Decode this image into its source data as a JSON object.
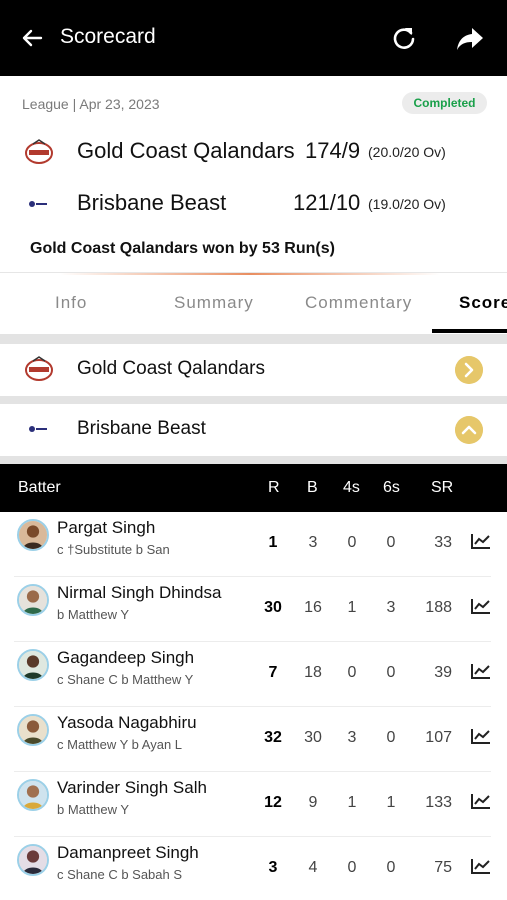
{
  "header": {
    "title": "Scorecard",
    "icons": [
      "back-arrow-icon",
      "refresh-icon",
      "share-icon"
    ]
  },
  "match": {
    "meta": "League | Apr 23, 2023",
    "status": "Completed",
    "status_color": "#1aa04a",
    "teams": [
      {
        "name": "Gold Coast Qalandars",
        "score": "174/9",
        "overs": "(20.0/20 Ov)"
      },
      {
        "name": "Brisbane Beast",
        "score": "121/10",
        "overs": "(19.0/20 Ov)"
      }
    ],
    "result": "Gold Coast Qalandars won by 53 Run(s)"
  },
  "tabs": [
    {
      "label": "Info"
    },
    {
      "label": "Summary"
    },
    {
      "label": "Commentary"
    },
    {
      "label": "Score",
      "active": true
    }
  ],
  "innings": [
    {
      "name": "Gold Coast Qalandars",
      "expanded": false
    },
    {
      "name": "Brisbane Beast",
      "expanded": true
    }
  ],
  "accent_color": "#e6c76a",
  "batting": {
    "columns": [
      "Batter",
      "R",
      "B",
      "4s",
      "6s",
      "SR"
    ],
    "rows": [
      {
        "name": "Pargat Singh",
        "dismissal": "c †Substitute b San",
        "r": "1",
        "b": "3",
        "fours": "0",
        "sixes": "0",
        "sr": "33"
      },
      {
        "name": "Nirmal Singh Dhindsa",
        "dismissal": "b Matthew Y",
        "r": "30",
        "b": "16",
        "fours": "1",
        "sixes": "3",
        "sr": "188"
      },
      {
        "name": "Gagandeep Singh",
        "dismissal": "c Shane C b Matthew Y",
        "r": "7",
        "b": "18",
        "fours": "0",
        "sixes": "0",
        "sr": "39"
      },
      {
        "name": "Yasoda Nagabhiru",
        "dismissal": "c Matthew Y b Ayan L",
        "r": "32",
        "b": "30",
        "fours": "3",
        "sixes": "0",
        "sr": "107"
      },
      {
        "name": "Varinder Singh Salh",
        "dismissal": "b Matthew Y",
        "r": "12",
        "b": "9",
        "fours": "1",
        "sixes": "1",
        "sr": "133"
      },
      {
        "name": "Damanpreet Singh",
        "dismissal": "c Shane C b Sabah S",
        "r": "3",
        "b": "4",
        "fours": "0",
        "sixes": "0",
        "sr": "75"
      }
    ]
  }
}
